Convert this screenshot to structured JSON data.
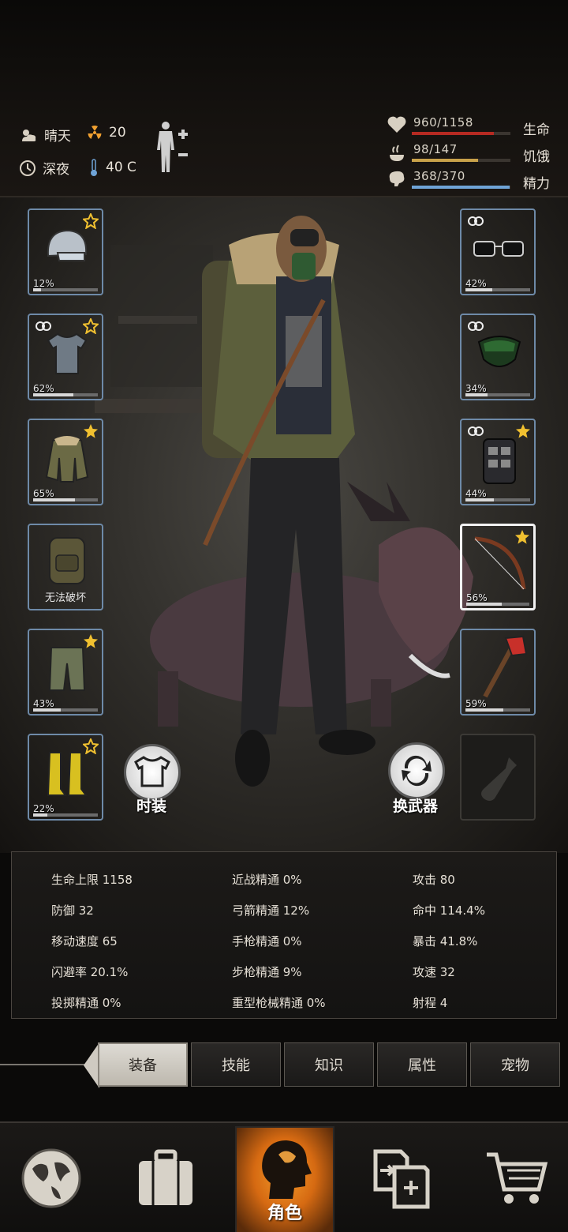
{
  "header": {
    "weather": "晴天",
    "radiation": "20",
    "time_of_day": "深夜",
    "temperature": "40 C"
  },
  "vitals": [
    {
      "value": "960/1158",
      "label": "生命",
      "fill": 0.83,
      "color": "#b52a22"
    },
    {
      "value": "98/147",
      "label": "饥饿",
      "fill": 0.67,
      "color": "#c9a24a"
    },
    {
      "value": "368/370",
      "label": "精力",
      "fill": 0.99,
      "color": "#6fa3d6"
    }
  ],
  "left_slots": [
    {
      "name": "helmet",
      "rarity": "blue",
      "pct": "12%",
      "dur": 0.12,
      "star": "outline"
    },
    {
      "name": "tshirt",
      "rarity": "green",
      "pct": "62%",
      "dur": 0.62,
      "star": "outline",
      "linked": true
    },
    {
      "name": "jacket",
      "rarity": "purple",
      "pct": "65%",
      "dur": 0.65,
      "star": "filled"
    },
    {
      "name": "backpack",
      "rarity": "purple",
      "note": "无法破坏"
    },
    {
      "name": "pants",
      "rarity": "purple",
      "pct": "43%",
      "dur": 0.43,
      "star": "filled"
    },
    {
      "name": "boots",
      "rarity": "purple",
      "pct": "22%",
      "dur": 0.22,
      "star": "outline"
    }
  ],
  "right_slots": [
    {
      "name": "sunglasses",
      "rarity": "blue",
      "pct": "42%",
      "dur": 0.42,
      "linked": true
    },
    {
      "name": "gas-mask",
      "rarity": "green",
      "pct": "34%",
      "dur": 0.34,
      "linked": true
    },
    {
      "name": "armor-vest",
      "rarity": "blue",
      "pct": "44%",
      "dur": 0.44,
      "star": "filled",
      "linked": true
    },
    {
      "name": "bow",
      "rarity": "blue",
      "pct": "56%",
      "dur": 0.56,
      "star": "filled",
      "selected": true
    },
    {
      "name": "fire-axe",
      "rarity": "blue",
      "pct": "59%",
      "dur": 0.59
    },
    {
      "name": "empty-bottle-slot",
      "rarity": "empty"
    }
  ],
  "buttons": {
    "outfit": "时装",
    "swap_weapon": "换武器"
  },
  "stats": {
    "col1": [
      "生命上限 1158",
      "防御 32",
      "移动速度 65",
      "闪避率 20.1%",
      "投掷精通 0%"
    ],
    "col2": [
      "近战精通 0%",
      "弓箭精通 12%",
      "手枪精通 0%",
      "步枪精通 9%",
      "重型枪械精通 0%"
    ],
    "col3": [
      "攻击 80",
      "命中 114.4%",
      "暴击 41.8%",
      "攻速 32",
      "射程 4"
    ]
  },
  "tabs": [
    "装备",
    "技能",
    "知识",
    "属性",
    "宠物"
  ],
  "nav": {
    "active_label": "角色",
    "icons": [
      "globe-icon",
      "suitcase-icon",
      "character-icon",
      "trade-icon",
      "cart-icon"
    ]
  }
}
